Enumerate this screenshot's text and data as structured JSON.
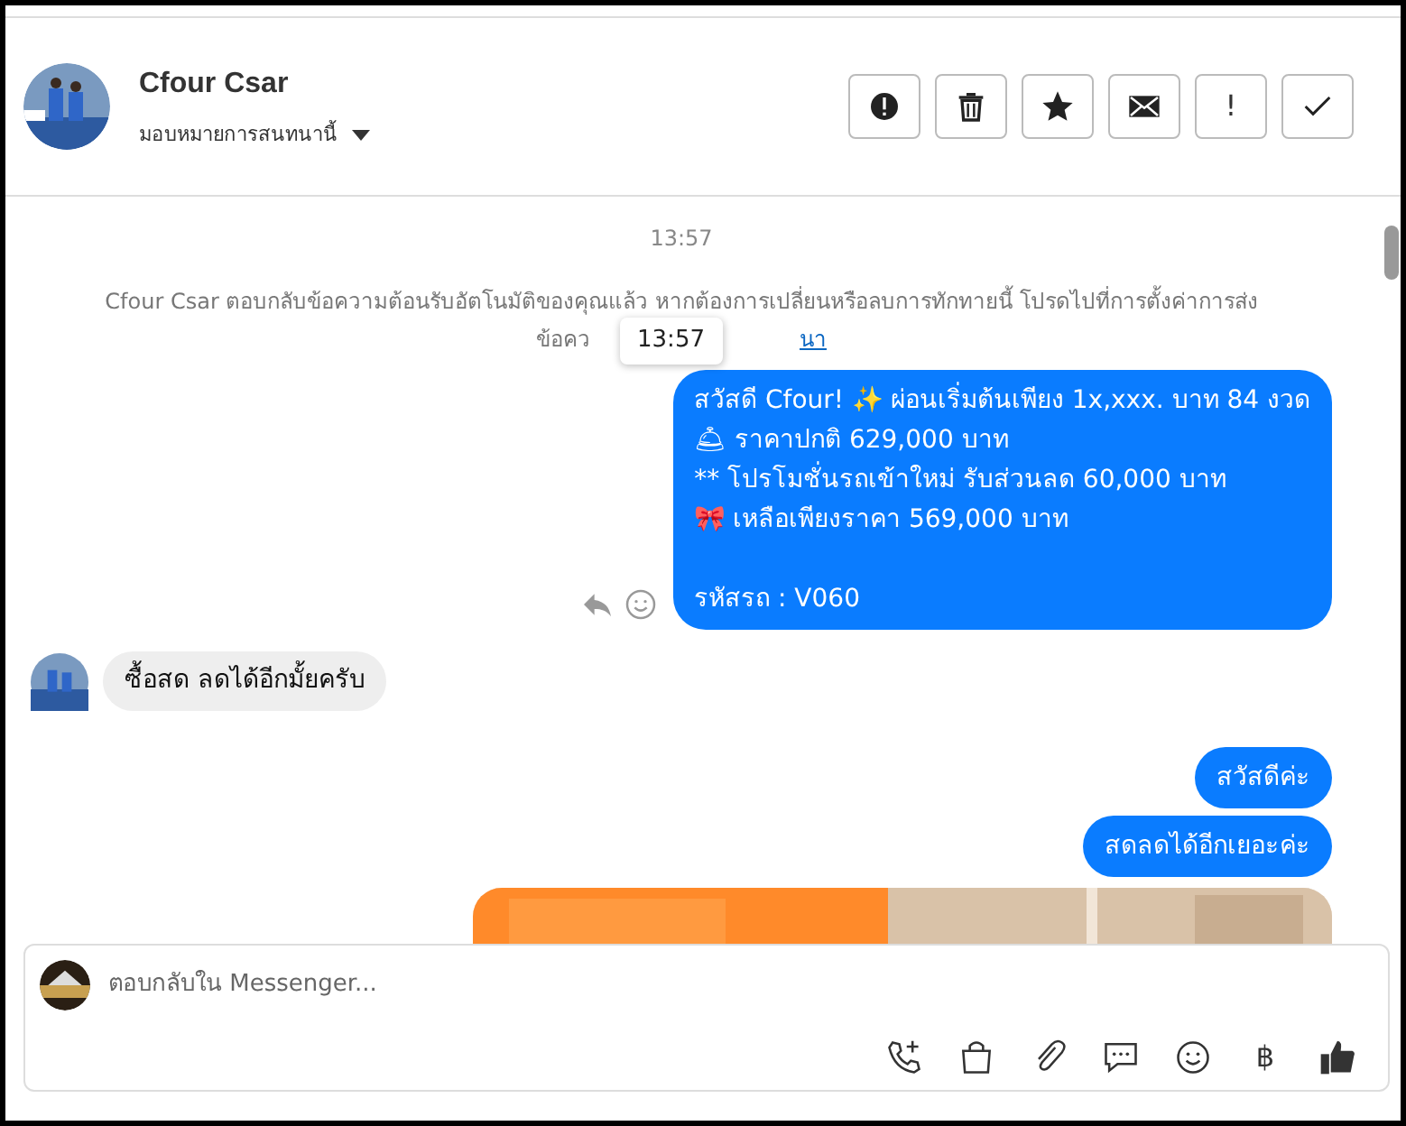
{
  "header": {
    "name": "Cfour Csar",
    "assign": "มอบหมายการสนทนานี้",
    "actions": [
      {
        "kind": "spam"
      },
      {
        "kind": "trash"
      },
      {
        "kind": "star"
      },
      {
        "kind": "mail"
      },
      {
        "kind": "text",
        "label": "!"
      },
      {
        "kind": "check"
      }
    ]
  },
  "timestamp": "13:57",
  "notice": {
    "line1": "Cfour Csar ตอบกลับข้อความต้อนรับอัตโนมัติของคุณแล้ว หากต้องการเปลี่ยนหรือลบการทักทายนี้ โปรดไปที่การตั้งค่าการส่ง",
    "line2": "ข้อคว",
    "link": "นา"
  },
  "tooltip": "13:57",
  "messages": [
    {
      "kind": "sent",
      "text": "สวัสดี Cfour! ✨  ผ่อนเริ่มต้นเพียง 1x,xxx. บาท 84 งวด\n🛎 ราคาปกติ 629,000 บาท\n** โปรโมชั่นรถเข้าใหม่ รับส่วนลด 60,000 บาท\n🎀  เหลือเพียงราคา 569,000 บาท\n\nรหัสรถ : V060",
      "actions": true
    },
    {
      "kind": "received",
      "text": "ซื้อสด ลดได้อีกมั้ยครับ"
    },
    {
      "kind": "sent",
      "text": "สวัสดีค่ะ"
    },
    {
      "kind": "sent",
      "text": "สดลดได้อีกเยอะค่ะ"
    },
    {
      "kind": "picture"
    }
  ],
  "composer": {
    "placeholder": "ตอบกลับใน Messenger...",
    "tools": [
      {
        "kind": "call"
      },
      {
        "kind": "bag"
      },
      {
        "kind": "clip"
      },
      {
        "kind": "chat"
      },
      {
        "kind": "emoji"
      },
      {
        "kind": "text",
        "label": "฿"
      },
      {
        "kind": "like"
      }
    ]
  }
}
